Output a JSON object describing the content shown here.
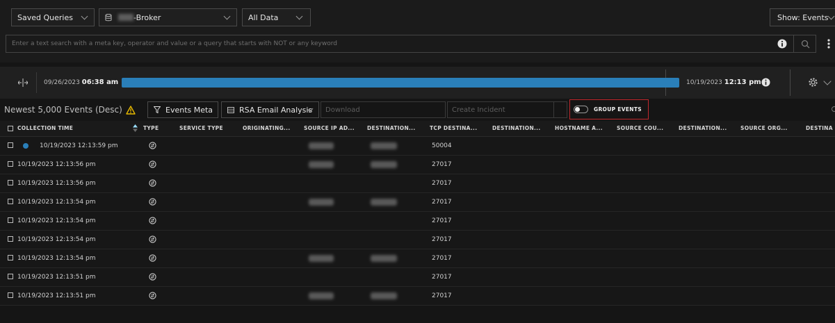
{
  "toolbar": {
    "saved_queries": "Saved Queries",
    "service": "-Broker",
    "all_data": "All Data",
    "show": "Show: Events"
  },
  "search": {
    "placeholder": "Enter a text search with a meta key, operator and value or a query that starts with NOT or any keyword"
  },
  "timeline": {
    "start_date": "09/26/2023",
    "start_time": "06:38 am",
    "end_date": "10/19/2023",
    "end_time": "12:13 pm"
  },
  "events_toolbar": {
    "count_label": "Newest 5,000 Events (Desc)",
    "events_meta": "Events Meta",
    "rsa_email": "RSA Email Analysis",
    "download": "Download",
    "create_incident": "Create Incident",
    "group_events": "GROUP EVENTS"
  },
  "table": {
    "columns": [
      "COLLECTION TIME",
      "TYPE",
      "SERVICE TYPE",
      "ORIGINATING...",
      "SOURCE IP AD...",
      "DESTINATION...",
      "TCP DESTINA...",
      "DESTINATION...",
      "HOSTNAME A...",
      "SOURCE COU...",
      "DESTINATION...",
      "SOURCE ORG...",
      "DESTINA"
    ],
    "rows": [
      {
        "time": "10/19/2023 12:13:59 pm",
        "port": "50004"
      },
      {
        "time": "10/19/2023 12:13:56 pm",
        "port": "27017"
      },
      {
        "time": "10/19/2023 12:13:56 pm",
        "port": "27017"
      },
      {
        "time": "10/19/2023 12:13:54 pm",
        "port": "27017"
      },
      {
        "time": "10/19/2023 12:13:54 pm",
        "port": "27017"
      },
      {
        "time": "10/19/2023 12:13:54 pm",
        "port": "27017"
      },
      {
        "time": "10/19/2023 12:13:54 pm",
        "port": "27017"
      },
      {
        "time": "10/19/2023 12:13:51 pm",
        "port": "27017"
      },
      {
        "time": "10/19/2023 12:13:51 pm",
        "port": "27017"
      }
    ]
  },
  "colors": {
    "accent_bar": "#2a7fb9",
    "warning": "#e6b800",
    "highlight_border": "#c0282d"
  }
}
